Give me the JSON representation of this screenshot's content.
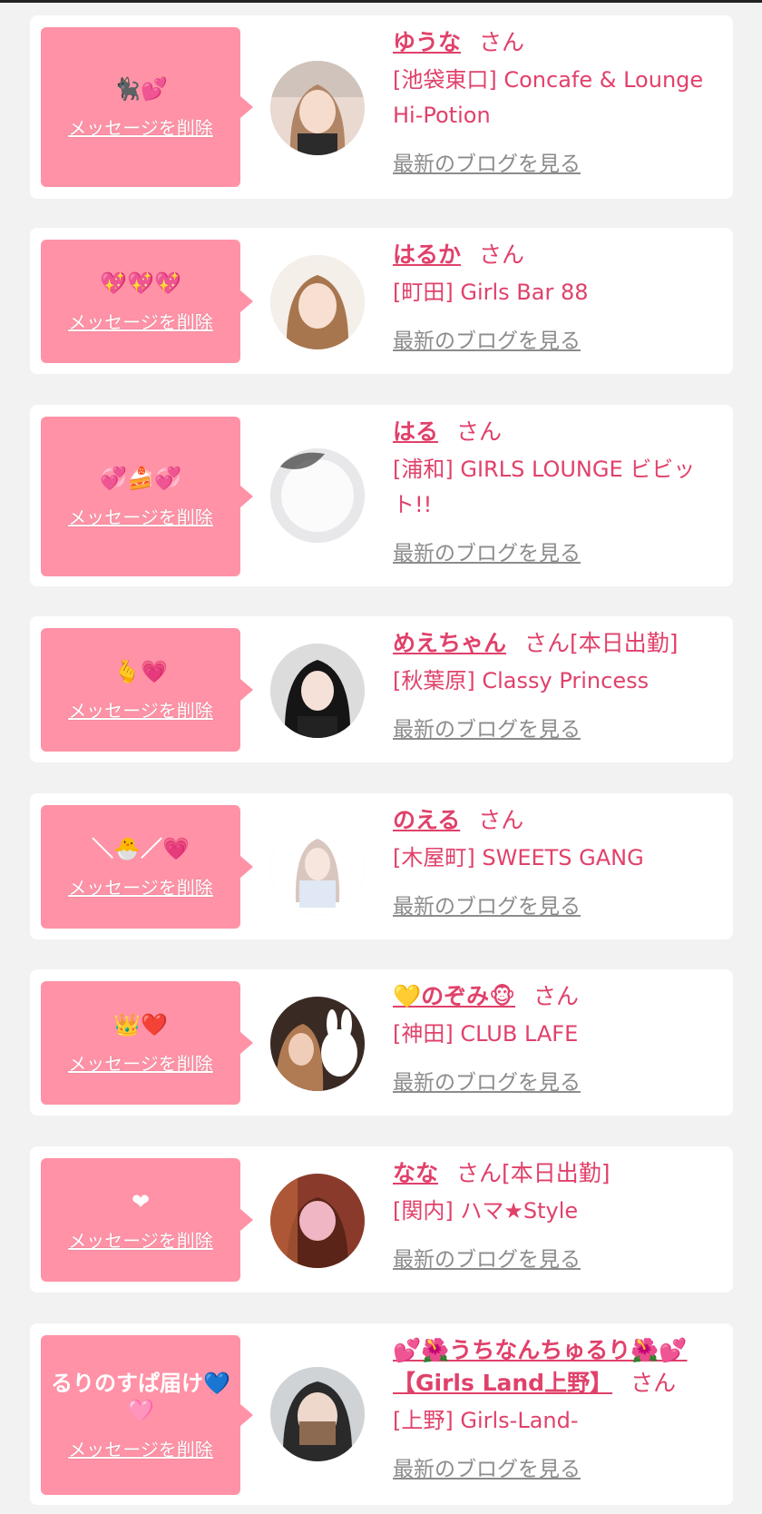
{
  "ui": {
    "delete_label": "メッセージを削除",
    "san_label": "さん",
    "blog_label": "最新のブログを見る"
  },
  "colors": {
    "bubble": "#ff92a6",
    "accent": "#e0416a",
    "muted": "#8c8c8c",
    "background": "#f2f2f2"
  },
  "entries": [
    {
      "message": "🐈‍⬛💕",
      "name": "ゆうな",
      "status": "",
      "shop": "[池袋東口] Concafe & Lounge Hi-Potion"
    },
    {
      "message": "💖💖💖",
      "name": "はるか",
      "status": "",
      "shop": "[町田] Girls Bar 88"
    },
    {
      "message": "💞🍰💞",
      "name": "はる",
      "status": "",
      "shop": "[浦和] GIRLS LOUNGE ビビット!!"
    },
    {
      "message": "🫰💗",
      "name": "めえちゃん",
      "status": "[本日出勤]",
      "shop": "[秋葉原] Classy Princess"
    },
    {
      "message": "＼🐣／💗",
      "name": "のえる",
      "status": "",
      "shop": "[木屋町] SWEETS GANG"
    },
    {
      "message": "👑❤️",
      "name": "💛のぞみ🐵",
      "status": "",
      "shop": "[神田] CLUB LAFE"
    },
    {
      "message": "❤",
      "name": "なな",
      "status": "[本日出勤]",
      "shop": "[関内] ハマ★Style"
    },
    {
      "message": "るりのすぱ届け💙🩷",
      "name": "💕🌺うちなんちゅるり🌺💕【Girls Land上野】",
      "status": "",
      "shop": "[上野] Girls-Land-"
    }
  ]
}
